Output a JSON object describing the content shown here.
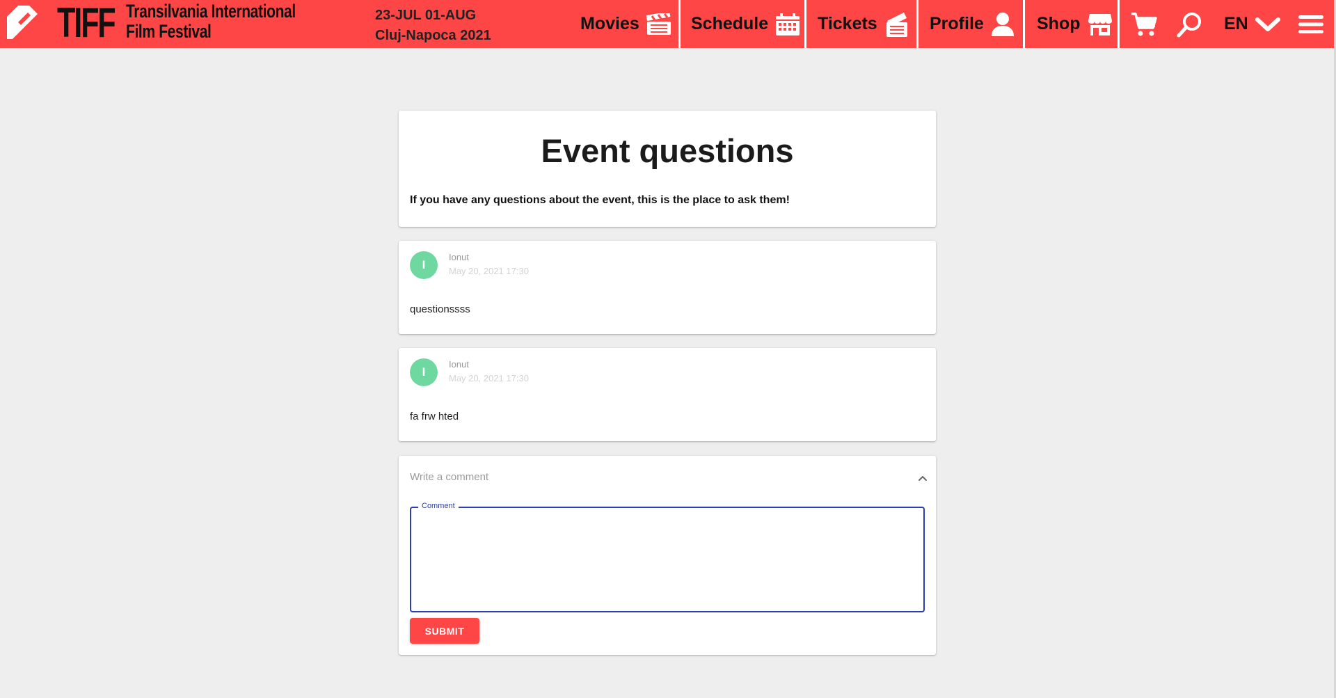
{
  "header": {
    "logo_text": "TIFF",
    "festival_name_line1": "Transilvania International",
    "festival_name_line2": "Film Festival",
    "dates_line1": "23-JUL 01-AUG",
    "dates_line2": "Cluj-Napoca 2021",
    "brand_color": "#ff4646",
    "nav": [
      {
        "label": "Movies",
        "icon": "clapperboard-icon"
      },
      {
        "label": "Schedule",
        "icon": "calendar-icon"
      },
      {
        "label": "Tickets",
        "icon": "ticket-icon"
      },
      {
        "label": "Profile",
        "icon": "user-icon"
      },
      {
        "label": "Shop",
        "icon": "store-icon"
      }
    ],
    "cart_icon": "cart-icon",
    "search_icon": "search-icon",
    "language": "EN",
    "menu_icon": "hamburger-menu-icon"
  },
  "intro": {
    "title": "Event questions",
    "subtitle": "If you have any questions about the event, this is the place to ask them!"
  },
  "comments": [
    {
      "initial": "I",
      "author": "Ionut",
      "timestamp": "May 20, 2021 17:30",
      "text": "questionssss"
    },
    {
      "initial": "I",
      "author": "Ionut",
      "timestamp": "May 20, 2021 17:30",
      "text": "fa frw hted"
    }
  ],
  "composer": {
    "header_label": "Write a comment",
    "field_label": "Comment",
    "value": "",
    "submit_label": "SUBMIT",
    "accent_color": "#2a3eb1"
  }
}
